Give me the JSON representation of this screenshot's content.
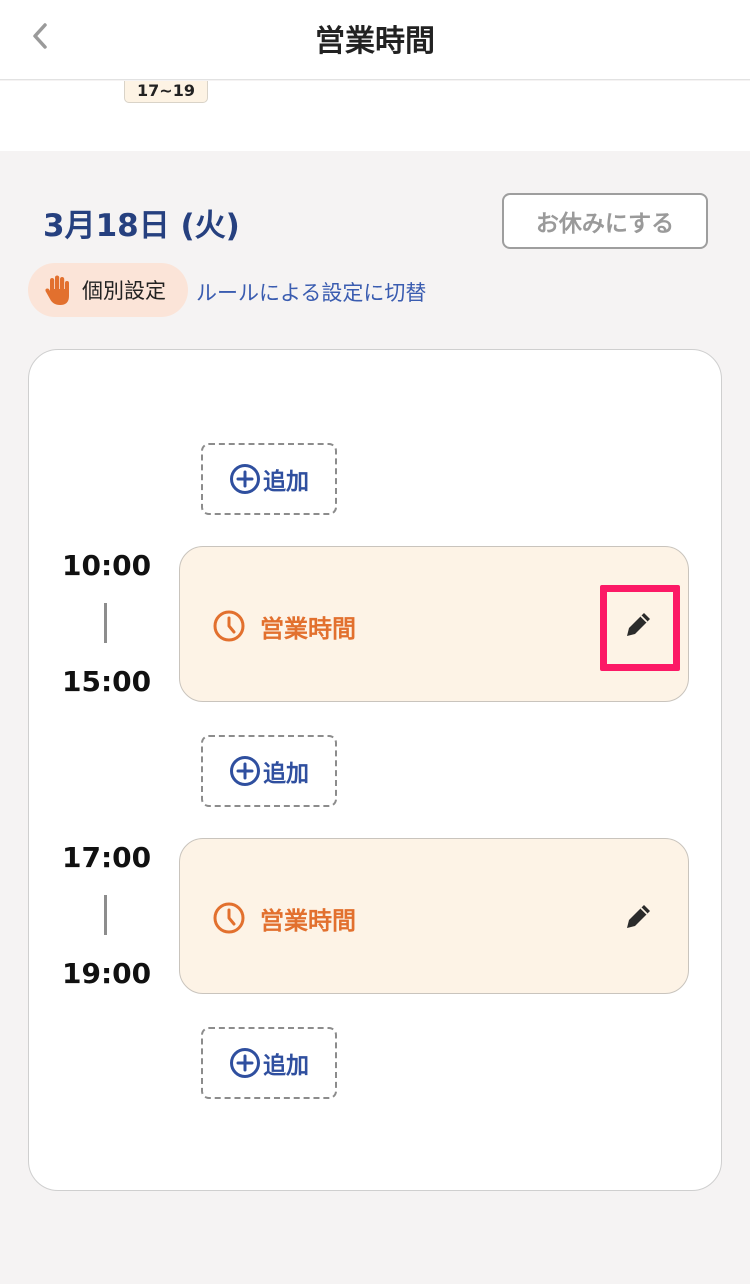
{
  "header": {
    "title": "営業時間",
    "back_icon": "chevron-left-icon"
  },
  "top_strip": {
    "chip_text": "17~19"
  },
  "day": {
    "date": "3月18日 (火)",
    "holiday_button": "お休みにする",
    "badge_label": "個別設定",
    "badge_icon": "hand-icon",
    "switch_link": "ルールによる設定に切替"
  },
  "schedule": {
    "add_label": "追加",
    "slots": [
      {
        "start": "10:00",
        "end": "15:00",
        "label": "営業時間"
      },
      {
        "start": "17:00",
        "end": "19:00",
        "label": "営業時間"
      }
    ]
  },
  "colors": {
    "accent_orange": "#e2702e",
    "date_blue": "#26407f",
    "link_blue": "#3a5cb0",
    "highlight": "#fc1966"
  }
}
